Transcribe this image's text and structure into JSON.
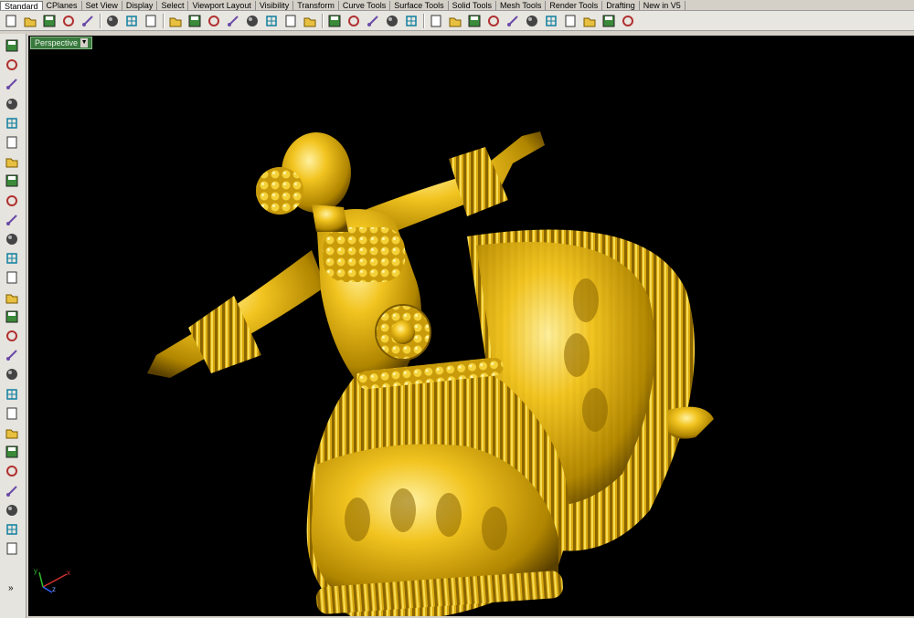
{
  "tabs": [
    {
      "label": "Standard",
      "active": true
    },
    {
      "label": "CPlanes"
    },
    {
      "label": "Set View"
    },
    {
      "label": "Display"
    },
    {
      "label": "Select"
    },
    {
      "label": "Viewport Layout"
    },
    {
      "label": "Visibility"
    },
    {
      "label": "Transform"
    },
    {
      "label": "Curve Tools"
    },
    {
      "label": "Surface Tools"
    },
    {
      "label": "Solid Tools"
    },
    {
      "label": "Mesh Tools"
    },
    {
      "label": "Render Tools"
    },
    {
      "label": "Drafting"
    },
    {
      "label": "New in V5"
    }
  ],
  "toolbar_icons": [
    "new-icon",
    "open-icon",
    "save-icon",
    "print-icon",
    "import-icon",
    "cut-icon",
    "copy-icon",
    "paste-icon",
    "undo-icon",
    "pan-icon",
    "rotate-view-icon",
    "zoom-icon",
    "zoom-window-icon",
    "zoom-extents-icon",
    "zoom-selected-icon",
    "four-viewports-icon",
    "car-icon",
    "grid-snap-icon",
    "select-points-icon",
    "hide-icon",
    "show-icon",
    "light-icon",
    "lock-icon",
    "layer-icon",
    "material-icon",
    "color-wheel-icon",
    "render-icon",
    "sphere-icon",
    "shaded-icon",
    "options-icon",
    "properties-icon",
    "help-icon"
  ],
  "sidebar_icons": [
    "select-arrow-icon",
    "point-icon",
    "polyline-icon",
    "curve-icon",
    "circle-icon",
    "ellipse-icon",
    "arc-icon",
    "rectangle-icon",
    "polygon-icon",
    "fillet-icon",
    "surface-icon",
    "extrude-icon",
    "box-solid-icon",
    "boolean-icon",
    "cylinder-icon",
    "mesh-icon",
    "transform-icon",
    "analyze-icon",
    "dimension-icon",
    "group-icon",
    "split-icon",
    "rebuild-icon",
    "text-icon",
    "array-icon",
    "block-icon",
    "layout-icon",
    "render-box-icon"
  ],
  "viewport": {
    "label": "Perspective",
    "axis_x": "x",
    "axis_y": "y",
    "axis_z": "z"
  },
  "sidebar_more": "»",
  "colors": {
    "gold": "#e5b81c",
    "gold_dark": "#7a5a00",
    "viewport_bg": "#000000",
    "label_bg": "#3a7a3e"
  }
}
